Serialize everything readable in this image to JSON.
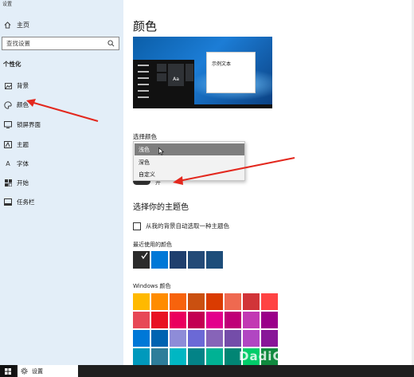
{
  "window_title": "设置",
  "sidebar": {
    "home": "主页",
    "search_placeholder": "查找设置",
    "section": "个性化",
    "items": [
      {
        "label": "背景",
        "icon": "image-icon"
      },
      {
        "label": "颜色",
        "icon": "palette-icon"
      },
      {
        "label": "锁屏界面",
        "icon": "lock-screen-icon"
      },
      {
        "label": "主题",
        "icon": "theme-icon"
      },
      {
        "label": "字体",
        "icon": "font-icon"
      },
      {
        "label": "开始",
        "icon": "start-icon"
      },
      {
        "label": "任务栏",
        "icon": "taskbar-icon"
      }
    ]
  },
  "main": {
    "title": "颜色",
    "preview": {
      "sample_text": "示例文本",
      "tile_text": "Aa"
    },
    "choose_color_label": "选择颜色",
    "dropdown_options": [
      "浅色",
      "深色",
      "自定义"
    ],
    "dropdown_selected": "浅色",
    "toggle_text": "开",
    "accent_heading": "选择你的主题色",
    "auto_pick_label": "从我的背景自动选取一种主题色",
    "recent_label": "最近使用的颜色",
    "recent_colors": [
      "#2b2b2b",
      "#0078d7",
      "#1f3f6e",
      "#234a77",
      "#1d4d7a"
    ],
    "windows_colors_label": "Windows 颜色",
    "windows_colors": [
      "#ffb900",
      "#ff8c00",
      "#f7630c",
      "#ca5010",
      "#da3b01",
      "#ef6950",
      "#d13438",
      "#ff4343",
      "#e74856",
      "#e81123",
      "#ea005e",
      "#c30052",
      "#e3008c",
      "#bf0077",
      "#c239b3",
      "#9a0089",
      "#0078d7",
      "#0063b1",
      "#8e8cd8",
      "#6b69d6",
      "#8764b8",
      "#744da9",
      "#b146c2",
      "#881798",
      "#0099bc",
      "#2d7d9a",
      "#00b7c3",
      "#038387",
      "#00b294",
      "#018574",
      "#00cc6a",
      "#10893e"
    ]
  },
  "taskbar": {
    "app_label": "设置"
  },
  "watermark": "DadiGhost.com"
}
